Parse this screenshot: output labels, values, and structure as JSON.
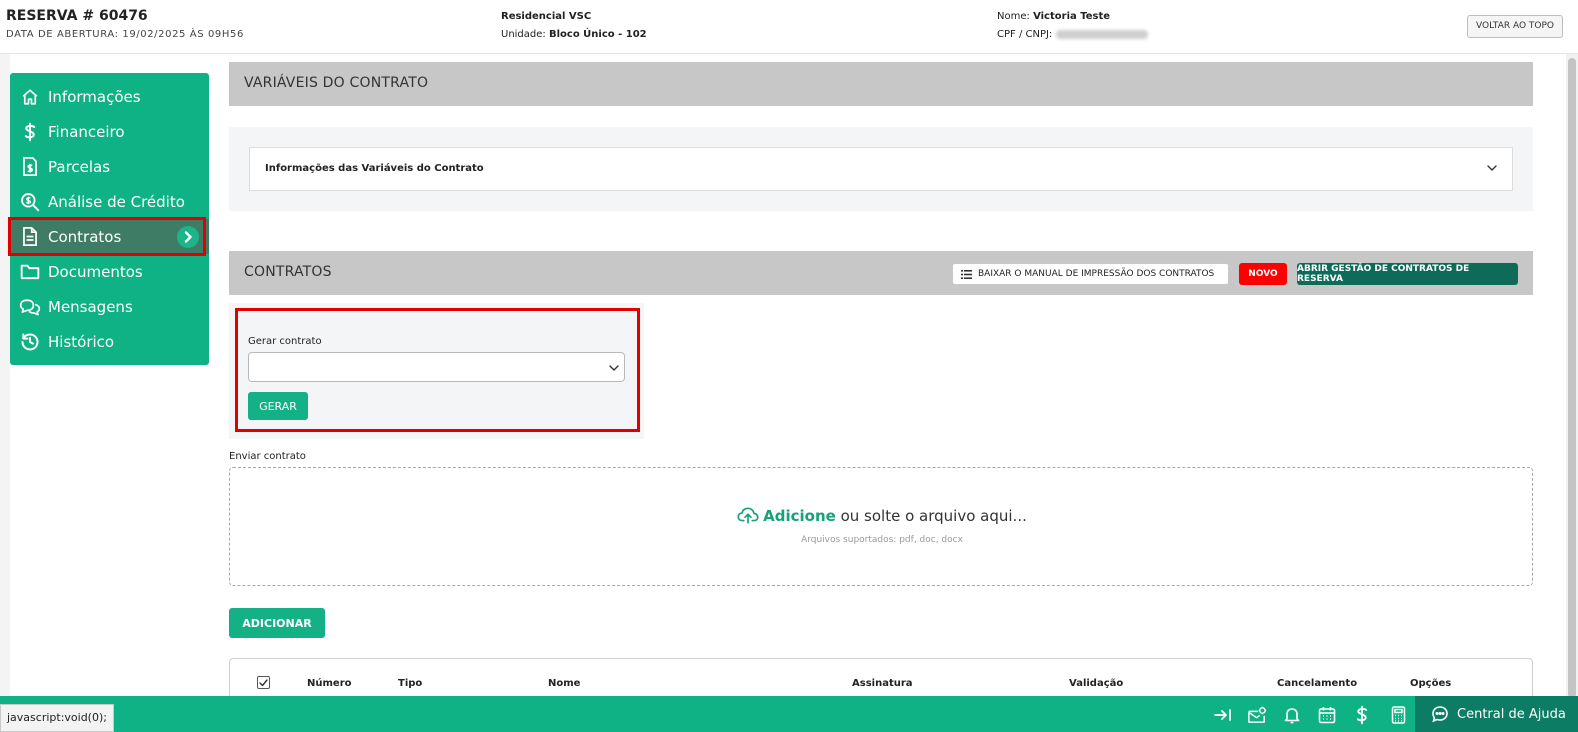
{
  "header": {
    "reservation_title": "RESERVA # 60476",
    "opening_date": "DATA DE ABERTURA: 19/02/2025 ÀS 09H56",
    "development_name": "Residencial VSC",
    "unit_label": "Unidade:",
    "unit_value": "Bloco Único - 102",
    "client_name_label": "Nome:",
    "client_name_value": "Victoria Teste",
    "cpf_label": "CPF / CNPJ:",
    "back_to_top_label": "VOLTAR AO TOPO"
  },
  "sidebar": {
    "items": [
      {
        "label": "Informações",
        "icon": "home-icon"
      },
      {
        "label": "Financeiro",
        "icon": "dollar-icon"
      },
      {
        "label": "Parcelas",
        "icon": "invoice-icon"
      },
      {
        "label": "Análise de Crédito",
        "icon": "credit-search-icon"
      },
      {
        "label": "Contratos",
        "icon": "document-icon",
        "active": true
      },
      {
        "label": "Documentos",
        "icon": "folder-icon"
      },
      {
        "label": "Mensagens",
        "icon": "chat-icon"
      },
      {
        "label": "Histórico",
        "icon": "history-icon"
      }
    ]
  },
  "variables_section": {
    "title": "VARIÁVEIS DO CONTRATO",
    "accordion_label": "Informações das Variáveis do Contrato"
  },
  "contracts_section": {
    "title": "CONTRATOS",
    "manual_button_label": "BAIXAR O MANUAL DE IMPRESSÃO DOS CONTRATOS",
    "new_badge": "NOVO",
    "management_button_label": "ABRIR GESTÃO DE CONTRATOS DE RESERVA",
    "generate_label": "Gerar contrato",
    "generate_select_value": "",
    "generate_button_label": "GERAR",
    "send_label": "Enviar contrato",
    "dropzone_action": "Adicione",
    "dropzone_text": "ou solte o arquivo aqui...",
    "dropzone_supported": "Arquivos suportados: pdf, doc, docx",
    "add_button_label": "ADICIONAR",
    "table_headers": [
      "Número",
      "Tipo",
      "Nome",
      "Assinatura",
      "Validação",
      "Cancelamento",
      "Opções"
    ]
  },
  "footer": {
    "status_text": "javascript:void(0);",
    "help_label": "Central de Ajuda"
  },
  "colors": {
    "primary": "#0fb284",
    "primary_dark": "#0d6b58",
    "alert": "#ff0000",
    "section_gray": "#c7c7c7"
  }
}
